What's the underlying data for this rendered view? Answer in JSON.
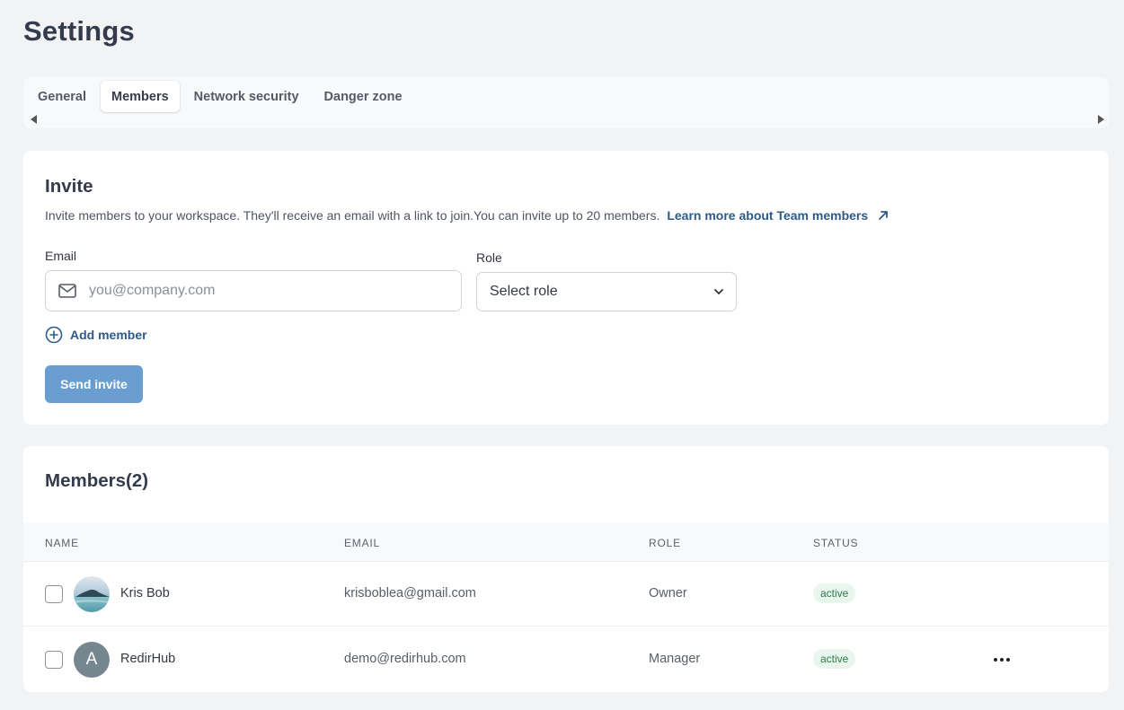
{
  "page": {
    "title": "Settings"
  },
  "tabs": [
    {
      "label": "General",
      "active": false
    },
    {
      "label": "Members",
      "active": true
    },
    {
      "label": "Network security",
      "active": false
    },
    {
      "label": "Danger zone",
      "active": false
    }
  ],
  "invite": {
    "title": "Invite",
    "description": "Invite members to your workspace. They'll receive an email with a link to join.You can invite up to 20 members.",
    "learn_more_label": "Learn more about Team members",
    "email_label": "Email",
    "email_placeholder": "you@company.com",
    "email_value": "",
    "role_label": "Role",
    "role_selected": "Select role",
    "add_member_label": "Add member",
    "send_button_label": "Send invite"
  },
  "members": {
    "title": "Members(2)",
    "columns": {
      "name": "NAME",
      "email": "EMAIL",
      "role": "ROLE",
      "status": "STATUS"
    },
    "rows": [
      {
        "name": "Kris Bob",
        "email": "krisboblea@gmail.com",
        "role": "Owner",
        "status": "active",
        "avatar": "landscape-photo",
        "checked": false
      },
      {
        "name": "RedirHub",
        "email": "demo@redirhub.com",
        "role": "Manager",
        "status": "active",
        "avatar_letter": "A",
        "checked": false
      }
    ]
  },
  "colors": {
    "page_bg": "#f2f3f5",
    "accent_link": "#2d5b89",
    "button_bg": "#6b9ed0",
    "badge_bg": "#e8f6ee",
    "badge_text": "#2f7a4a"
  },
  "icons": {
    "external_link": "arrow-up-right-icon",
    "email": "mail-icon",
    "select": "chevron-down-icon",
    "add": "plus-circle-icon",
    "row_menu": "more-horizontal-icon"
  }
}
